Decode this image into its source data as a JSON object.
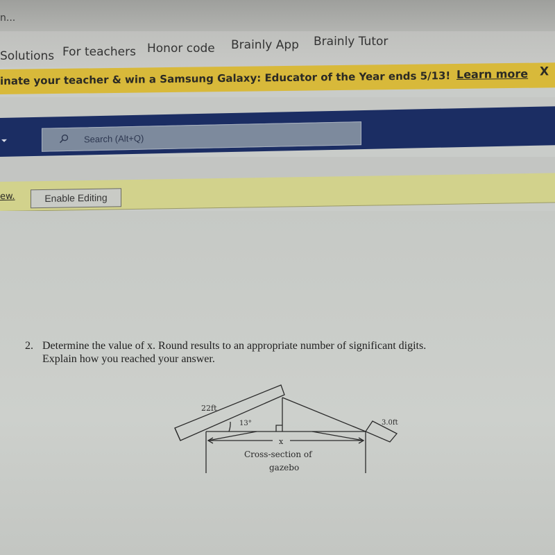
{
  "browser": {
    "truncated_title": "n..."
  },
  "nav": {
    "items": [
      {
        "label": "Solutions"
      },
      {
        "label": "For teachers"
      },
      {
        "label": "Honor code"
      },
      {
        "label": "Brainly App"
      },
      {
        "label": "Brainly Tutor"
      }
    ]
  },
  "promo": {
    "text": "inate your teacher & win a Samsung Galaxy: Educator of the Year ends 5/13!",
    "link_label": "Learn more",
    "close_label": "X"
  },
  "office": {
    "search_placeholder": "Search (Alt+Q)",
    "icon": "search-icon"
  },
  "protected_view": {
    "view_link": "ew.",
    "enable_button": "Enable Editing"
  },
  "question": {
    "number": "2.",
    "line1": "Determine the value of x.  Round results to an appropriate number of significant digits.",
    "line2": "Explain how you reached your answer."
  },
  "diagram": {
    "label_rafter": "22ft",
    "label_angle": "13°",
    "label_overhang": "3.0ft",
    "label_x": "x",
    "caption_line1": "Cross-section of",
    "caption_line2": "gazebo"
  }
}
